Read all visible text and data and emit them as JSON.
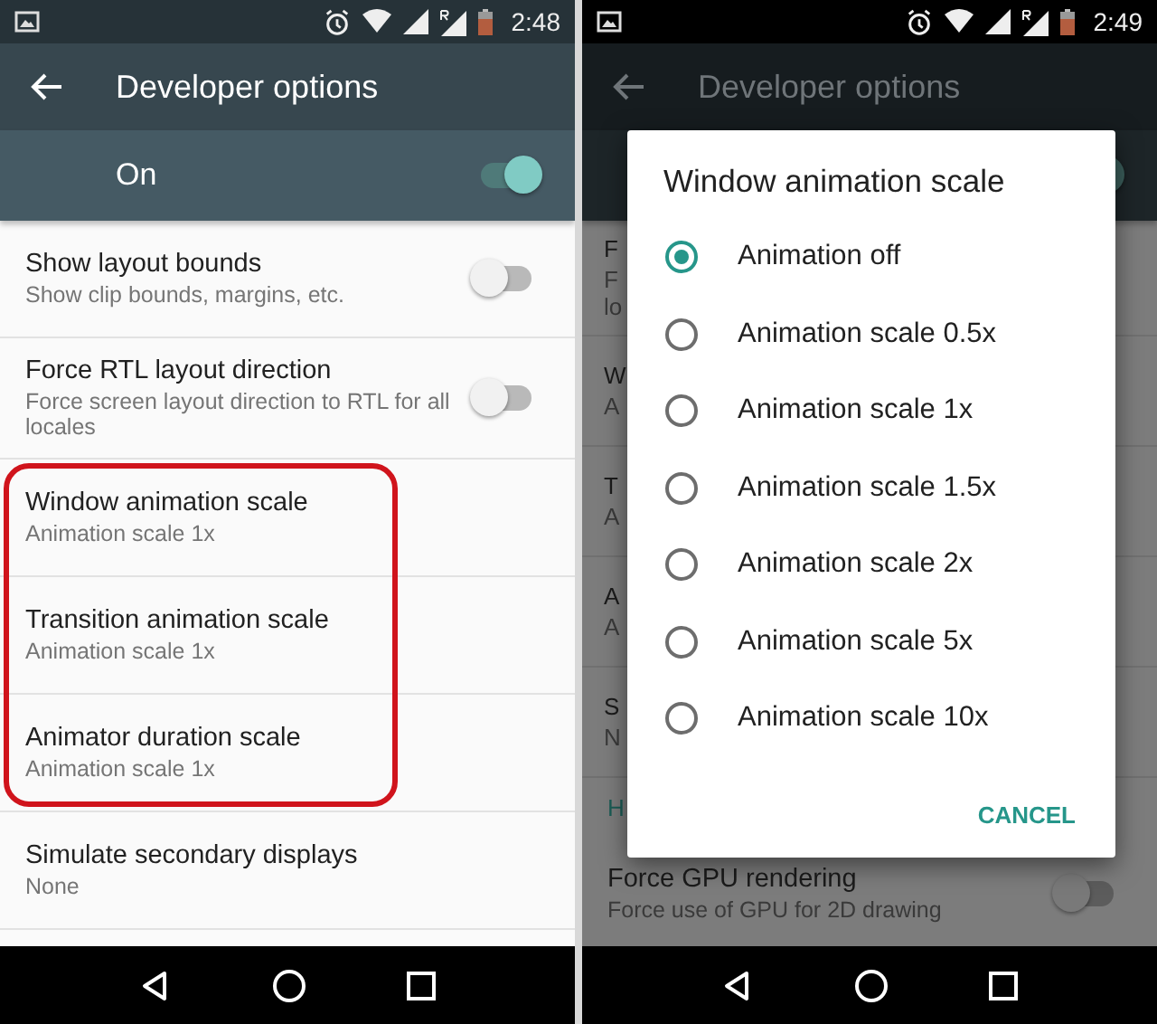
{
  "phones": [
    {
      "status_bar": {
        "time": "2:48"
      },
      "toolbar": {
        "title": "Developer options"
      },
      "master_switch": {
        "label": "On",
        "on": true
      },
      "settings": [
        {
          "kind": "toggle",
          "title": "Show layout bounds",
          "summary": "Show clip bounds, margins, etc.",
          "on": false,
          "highlighted": false
        },
        {
          "kind": "toggle",
          "title": "Force RTL layout direction",
          "summary": "Force screen layout direction to RTL for all locales",
          "on": false,
          "highlighted": false
        },
        {
          "kind": "value",
          "title": "Window animation scale",
          "summary": "Animation scale 1x",
          "highlighted": true
        },
        {
          "kind": "value",
          "title": "Transition animation scale",
          "summary": "Animation scale 1x",
          "highlighted": true
        },
        {
          "kind": "value",
          "title": "Animator duration scale",
          "summary": "Animation scale 1x",
          "highlighted": true
        },
        {
          "kind": "value",
          "title": "Simulate secondary displays",
          "summary": "None",
          "highlighted": false
        }
      ]
    },
    {
      "status_bar": {
        "time": "2:49"
      },
      "toolbar": {
        "title": "Developer options"
      },
      "master_switch": {
        "on": true
      },
      "settings": [
        {
          "kind": "fragment",
          "title": "F",
          "summary": "F lo"
        },
        {
          "kind": "fragment",
          "title": "W",
          "summary": "A"
        },
        {
          "kind": "fragment",
          "title": "T",
          "summary": "A"
        },
        {
          "kind": "fragment",
          "title": "A",
          "summary": "A"
        },
        {
          "kind": "fragment",
          "title": "S",
          "summary": "N"
        },
        {
          "kind": "header",
          "title": "H"
        },
        {
          "kind": "toggle",
          "title": "Force GPU rendering",
          "summary": "Force use of GPU for 2D drawing",
          "on": false
        }
      ],
      "dialog": {
        "title": "Window animation scale",
        "options": [
          {
            "label": "Animation off",
            "selected": true
          },
          {
            "label": "Animation scale 0.5x",
            "selected": false
          },
          {
            "label": "Animation scale 1x",
            "selected": false
          },
          {
            "label": "Animation scale 1.5x",
            "selected": false
          },
          {
            "label": "Animation scale 2x",
            "selected": false
          },
          {
            "label": "Animation scale 5x",
            "selected": false
          },
          {
            "label": "Animation scale 10x",
            "selected": false
          }
        ],
        "button": "CANCEL"
      }
    }
  ]
}
